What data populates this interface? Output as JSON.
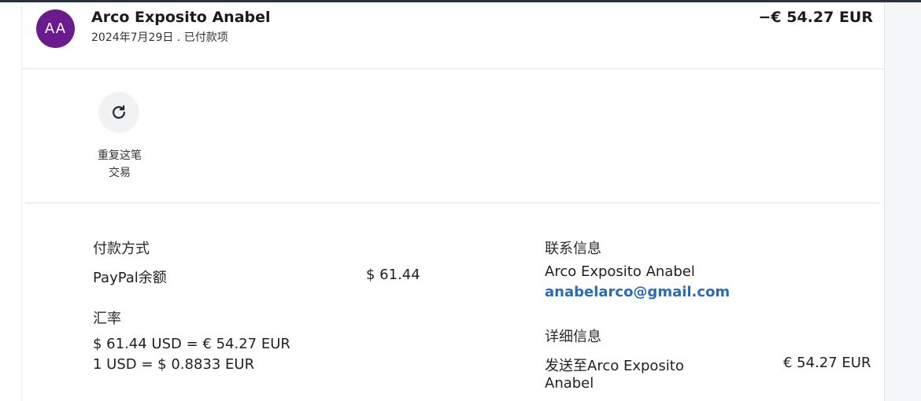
{
  "header": {
    "avatar_initials": "AA",
    "payee_name": "Arco Exposito Anabel",
    "date_status": "2024年7月29日 . 已付款项",
    "amount": "−€ 54.27 EUR"
  },
  "actions": {
    "repeat_icon": "refresh-icon",
    "repeat_label_line1": "重复这笔",
    "repeat_label_line2": "交易"
  },
  "payment": {
    "title": "付款方式",
    "method": "PayPal余额",
    "method_amount": "$ 61.44"
  },
  "exchange": {
    "title": "汇率",
    "line1": "$ 61.44 USD = € 54.27 EUR",
    "line2": "1 USD = $ 0.8833 EUR"
  },
  "contact": {
    "title": "联系信息",
    "name": "Arco Exposito Anabel",
    "email": "anabelarco@gmail.com"
  },
  "details": {
    "title": "详细信息",
    "sent_to_line1": "发送至Arco Exposito",
    "sent_to_line2": "Anabel",
    "sent_amount": "€ 54.27 EUR"
  },
  "colors": {
    "avatar_bg": "#6c1b8f",
    "link": "#2a6bb8"
  }
}
